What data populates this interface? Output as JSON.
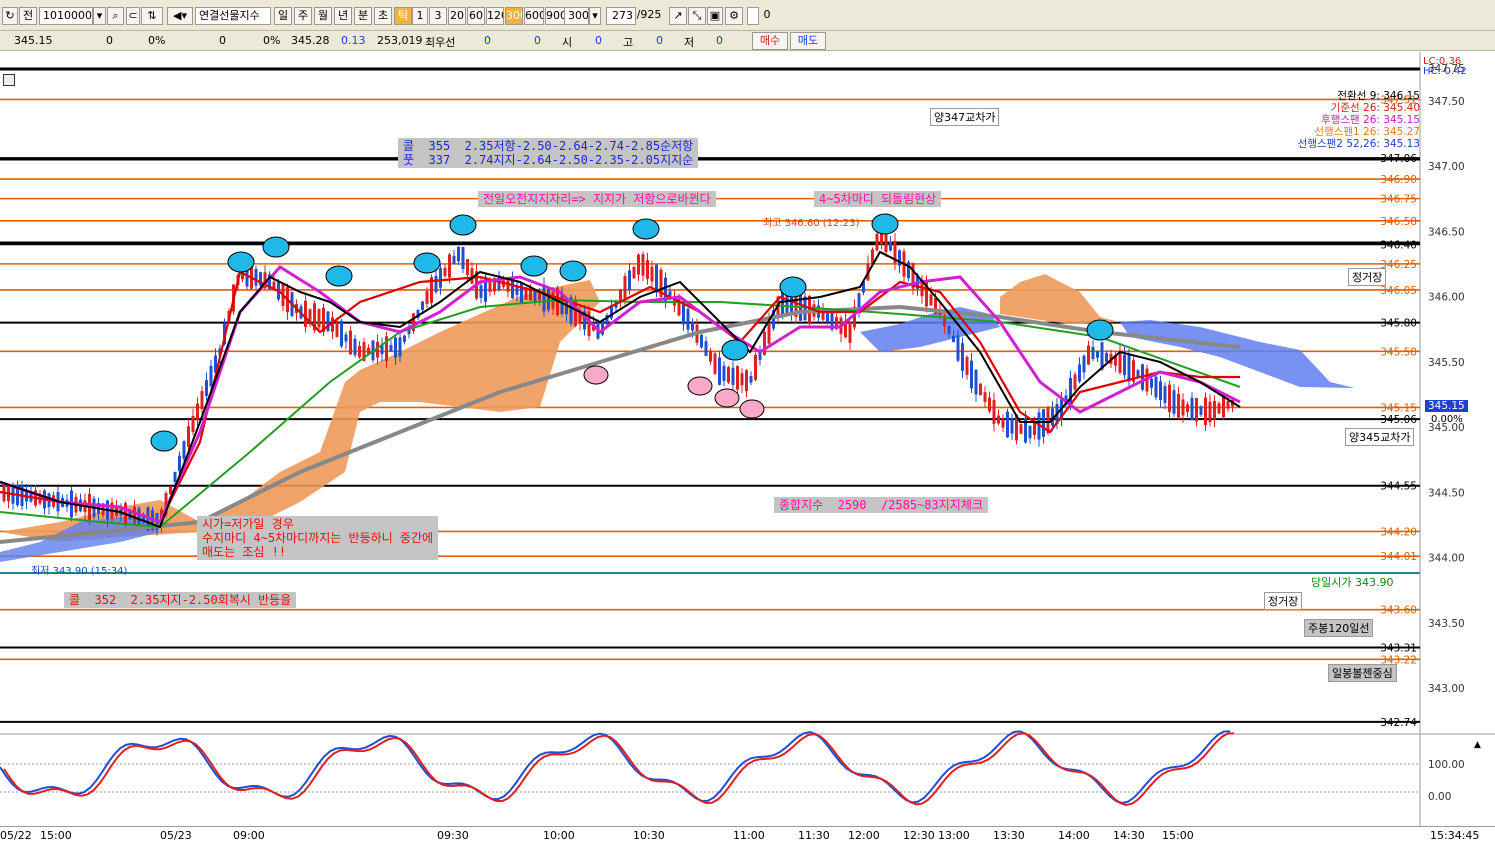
{
  "toolbar": {
    "code": "10100000",
    "product": "연결선물지수",
    "prefix_btn": "전",
    "period_buttons": [
      "일",
      "주",
      "월",
      "년",
      "분",
      "초",
      "틱"
    ],
    "selected_period": "틱",
    "interval_buttons": [
      "1",
      "3",
      "20",
      "60",
      "120",
      "300",
      "600",
      "900"
    ],
    "selected_interval": "300",
    "interval_value": "300",
    "bar_count": "273",
    "bar_total": "/925",
    "checkbox_label": "0"
  },
  "quote": {
    "price": "345.15",
    "vol1": "0",
    "pct1": "0%",
    "vol2": "0",
    "pct2": "0%",
    "price2": "345.28",
    "change": "0.13",
    "volume": "253,019",
    "priority_label": "최우선",
    "pv1": "0",
    "pv2": "0",
    "open_label": "시",
    "open_val": "0",
    "high_label": "고",
    "high_val": "0",
    "low_label": "저",
    "low_val": "0",
    "buy": "매수",
    "sell": "매도"
  },
  "price_axis": [
    "347.75",
    "347.50",
    "347.00",
    "346.50",
    "346.00",
    "345.50",
    "345.00",
    "344.50",
    "344.00",
    "343.50",
    "343.00"
  ],
  "current_price_tag": "345.15",
  "current_pct": "0.00%",
  "lc": "LC:0.36",
  "hc": "HC:-0.42",
  "hlines": [
    {
      "label": "347.51",
      "color": "#e06000"
    },
    {
      "label": "347.06",
      "color": "#000000"
    },
    {
      "label": "346.90",
      "color": "#e06000"
    },
    {
      "label": "346.75",
      "color": "#e06000"
    },
    {
      "label": "346.58",
      "color": "#e06000"
    },
    {
      "label": "346.40",
      "color": "#000000"
    },
    {
      "label": "346.25",
      "color": "#e06000"
    },
    {
      "label": "346.05",
      "color": "#e06000"
    },
    {
      "label": "345.80",
      "color": "#000000"
    },
    {
      "label": "345.58",
      "color": "#e06000"
    },
    {
      "label": "345.15",
      "color": "#e06000"
    },
    {
      "label": "345.06",
      "color": "#000000"
    },
    {
      "label": "344.55",
      "color": "#000000"
    },
    {
      "label": "344.20",
      "color": "#e06000"
    },
    {
      "label": "344.01",
      "color": "#e06000"
    },
    {
      "label": "343.60",
      "color": "#e06000"
    },
    {
      "label": "343.31",
      "color": "#000000"
    },
    {
      "label": "343.22",
      "color": "#e06000"
    },
    {
      "label": "342.74",
      "color": "#000000"
    }
  ],
  "legend_lines": [
    "전환선 9: 346.15",
    "기준선 26: 345.40",
    "후행스팬 26: 345.15",
    "선행스팬1 26: 345.27",
    "선행스팬2 52,26: 345.13"
  ],
  "annotations": {
    "call_put": "콜  355  2.35저항-2.50-2.64-2.74-2.85순저항\n풋  337  2.74지지-2.64-2.50-2.35-2.05지지순",
    "support_flip": "전일오전지지자리=> 지지가 저항으로바뀐다",
    "pullback": "4~5차마디 되돌림현상",
    "open_low": "시가=저가일 경우\n수지마디 4~5차마디까지는 반등하니 중간에\n매도는 조심 !!",
    "call352": "콜  352  2.35지지-2.50회복시 반등을",
    "kospi": "종합지수  2590  /2585~83지지체크",
    "yang347": "양347교차가",
    "yang345": "양345교차가",
    "jeonggeo1": "정거장",
    "jeonggeo2": "정거장",
    "weekly120": "주봉120일선",
    "bollinger": "일봉볼젠중심",
    "today_open": "당일시가  343.90",
    "high_note": "최고 346.60 (12:23)",
    "low_note": "최저 343.90 (15:34)"
  },
  "osc_axis": [
    "100.00",
    "0.00"
  ],
  "time_labels": [
    "05/22",
    "15:00",
    "05/23",
    "09:00",
    "09:30",
    "10:00",
    "10:30",
    "11:00",
    "11:30",
    "12:00",
    "12:30",
    "13:00",
    "13:30",
    "14:00",
    "14:30",
    "15:00",
    "15:34:45"
  ],
  "colors": {
    "orange_line": "#e06000",
    "black_line": "#000000",
    "cloud_orange": "#f09a5a",
    "cloud_blue": "#5f7ff0",
    "up_candle": "#e02020",
    "down_candle": "#2050d0",
    "ma_magenta": "#d020d0",
    "ma_black": "#000000",
    "ma_red": "#e00000",
    "ma_green": "#20a020",
    "ma_gray": "#888888"
  }
}
